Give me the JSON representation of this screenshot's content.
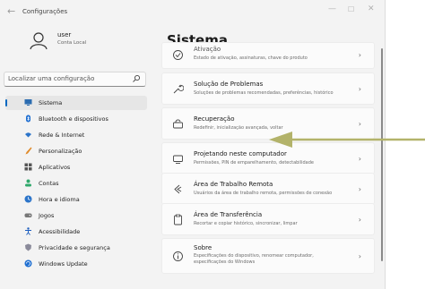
{
  "window": {
    "title": "Configurações",
    "back_icon": "back-arrow-icon",
    "controls": {
      "minimize": "—",
      "maximize": "☐",
      "close": "✕"
    }
  },
  "user": {
    "name": "user",
    "account": "Conta Local",
    "icon": "user-avatar-icon"
  },
  "search": {
    "placeholder": "Localizar uma configuração",
    "icon": "search-icon"
  },
  "sidebar": {
    "accent_color": "#0067c0",
    "items": [
      {
        "label": "Sistema",
        "icon": "monitor-icon",
        "active": true
      },
      {
        "label": "Bluetooth e dispositivos",
        "icon": "bluetooth-icon"
      },
      {
        "label": "Rede & Internet",
        "icon": "wifi-icon"
      },
      {
        "label": "Personalização",
        "icon": "brush-icon"
      },
      {
        "label": "Aplicativos",
        "icon": "apps-icon"
      },
      {
        "label": "Contas",
        "icon": "person-icon"
      },
      {
        "label": "Hora e idioma",
        "icon": "globe-clock-icon"
      },
      {
        "label": "Jogos",
        "icon": "gamepad-icon"
      },
      {
        "label": "Acessibilidade",
        "icon": "accessibility-icon"
      },
      {
        "label": "Privacidade e segurança",
        "icon": "shield-icon"
      },
      {
        "label": "Windows Update",
        "icon": "update-icon"
      }
    ]
  },
  "main": {
    "title": "Sistema",
    "cards": [
      {
        "title": "Ativação",
        "desc": "Estado de ativação, assinaturas, chave do produto",
        "icon": "check-circle-icon"
      },
      {
        "title": "Solução de Problemas",
        "desc": "Soluções de problemas recomendadas, preferências, histórico",
        "icon": "wrench-icon"
      },
      {
        "title": "Recuperação",
        "desc": "Redefinir, inicialização avançada, voltar",
        "icon": "recovery-icon"
      },
      {
        "title": "Projetando neste computador",
        "desc": "Permissões, PIN de emparelhamento, detectabilidade",
        "icon": "projector-icon"
      },
      {
        "title": "Área de Trabalho Remota",
        "desc": "Usuários da área de trabalho remota, permissões de conexão",
        "icon": "remote-desktop-icon"
      },
      {
        "title": "Área de Transferência",
        "desc": "Recortar e copiar histórico, sincronizar, limpar",
        "icon": "clipboard-icon"
      },
      {
        "title": "Sobre",
        "desc": "Especificações do dispositivo, renomear computador, especificações do Windows",
        "icon": "info-icon"
      }
    ],
    "chevron": "›"
  },
  "annotation": {
    "arrow_color": "#b3b36a",
    "points_to": "Recuperação"
  }
}
